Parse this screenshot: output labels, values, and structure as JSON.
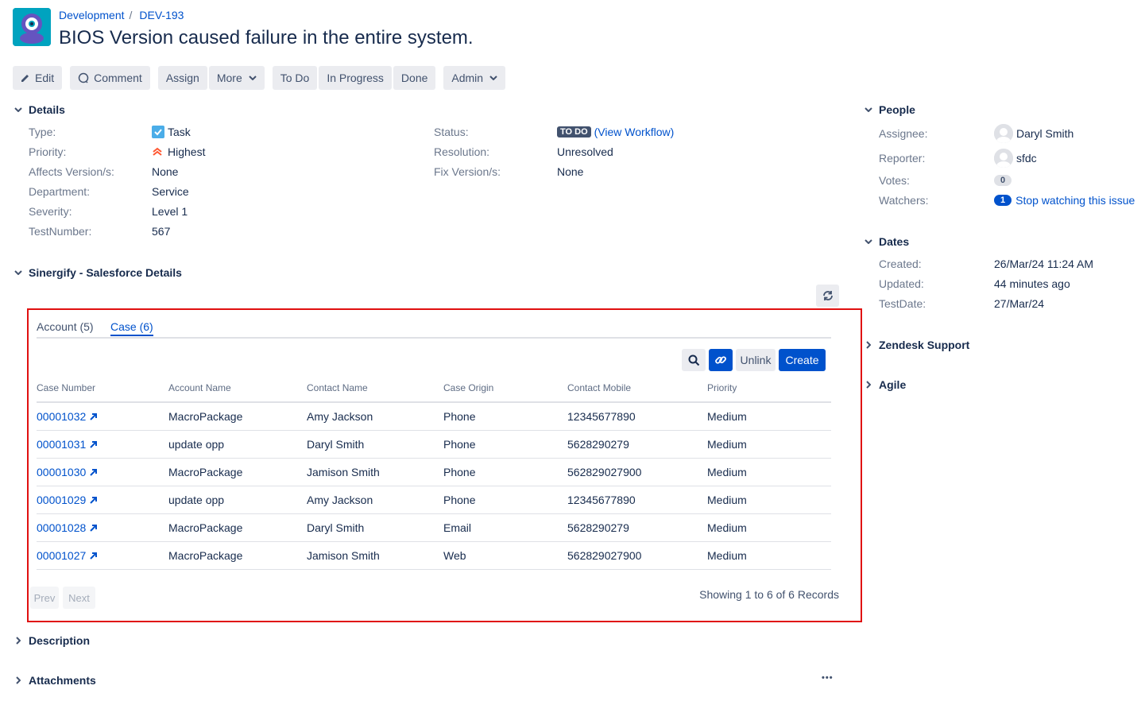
{
  "header": {
    "breadcrumb_project": "Development",
    "breadcrumb_sep": "/",
    "breadcrumb_issue": "DEV-193",
    "title": "BIOS Version caused failure in the entire system."
  },
  "toolbar": {
    "edit": "Edit",
    "comment": "Comment",
    "assign": "Assign",
    "more": "More",
    "todo": "To Do",
    "in_progress": "In Progress",
    "done": "Done",
    "admin": "Admin"
  },
  "details": {
    "heading": "Details",
    "type_label": "Type:",
    "type_value": "Task",
    "priority_label": "Priority:",
    "priority_value": "Highest",
    "affects_label": "Affects Version/s:",
    "affects_value": "None",
    "department_label": "Department:",
    "department_value": "Service",
    "severity_label": "Severity:",
    "severity_value": "Level 1",
    "testnumber_label": "TestNumber:",
    "testnumber_value": "567",
    "status_label": "Status:",
    "status_value": "TO DO",
    "view_workflow": "(View Workflow)",
    "resolution_label": "Resolution:",
    "resolution_value": "Unresolved",
    "fix_label": "Fix Version/s:",
    "fix_value": "None"
  },
  "salesforce": {
    "heading": "Sinergify - Salesforce Details",
    "tab_account": "Account (5)",
    "tab_case": "Case (6)",
    "unlink": "Unlink",
    "create": "Create",
    "columns": [
      "Case Number",
      "Account Name",
      "Contact Name",
      "Case Origin",
      "Contact Mobile",
      "Priority"
    ],
    "rows": [
      [
        "00001032",
        "MacroPackage",
        "Amy Jackson",
        "Phone",
        "12345677890",
        "Medium"
      ],
      [
        "00001031",
        "update opp",
        "Daryl Smith",
        "Phone",
        "5628290279",
        "Medium"
      ],
      [
        "00001030",
        "MacroPackage",
        "Jamison Smith",
        "Phone",
        "562829027900",
        "Medium"
      ],
      [
        "00001029",
        "update opp",
        "Amy Jackson",
        "Phone",
        "12345677890",
        "Medium"
      ],
      [
        "00001028",
        "MacroPackage",
        "Daryl Smith",
        "Email",
        "5628290279",
        "Medium"
      ],
      [
        "00001027",
        "MacroPackage",
        "Jamison Smith",
        "Web",
        "562829027900",
        "Medium"
      ]
    ],
    "prev": "Prev",
    "next": "Next",
    "showing": "Showing 1 to 6 of 6 Records"
  },
  "description": {
    "heading": "Description"
  },
  "attachments": {
    "heading": "Attachments",
    "more": "•••"
  },
  "people": {
    "heading": "People",
    "assignee_label": "Assignee:",
    "assignee_value": "Daryl Smith",
    "reporter_label": "Reporter:",
    "reporter_value": "sfdc",
    "votes_label": "Votes:",
    "votes_value": "0",
    "watchers_label": "Watchers:",
    "watchers_count": "1",
    "watchers_link": "Stop watching this issue"
  },
  "dates": {
    "heading": "Dates",
    "created_label": "Created:",
    "created_value": "26/Mar/24 11:24 AM",
    "updated_label": "Updated:",
    "updated_value": "44 minutes ago",
    "testdate_label": "TestDate:",
    "testdate_value": "27/Mar/24"
  },
  "zendesk": {
    "heading": "Zendesk Support"
  },
  "agile": {
    "heading": "Agile"
  },
  "colors": {
    "link": "#0052cc",
    "primary_button": "#0052cc",
    "highlight_border": "#e01010",
    "lozenge": "#42526e",
    "priority_highest": "#ff5630",
    "task_icon": "#4bade8"
  }
}
